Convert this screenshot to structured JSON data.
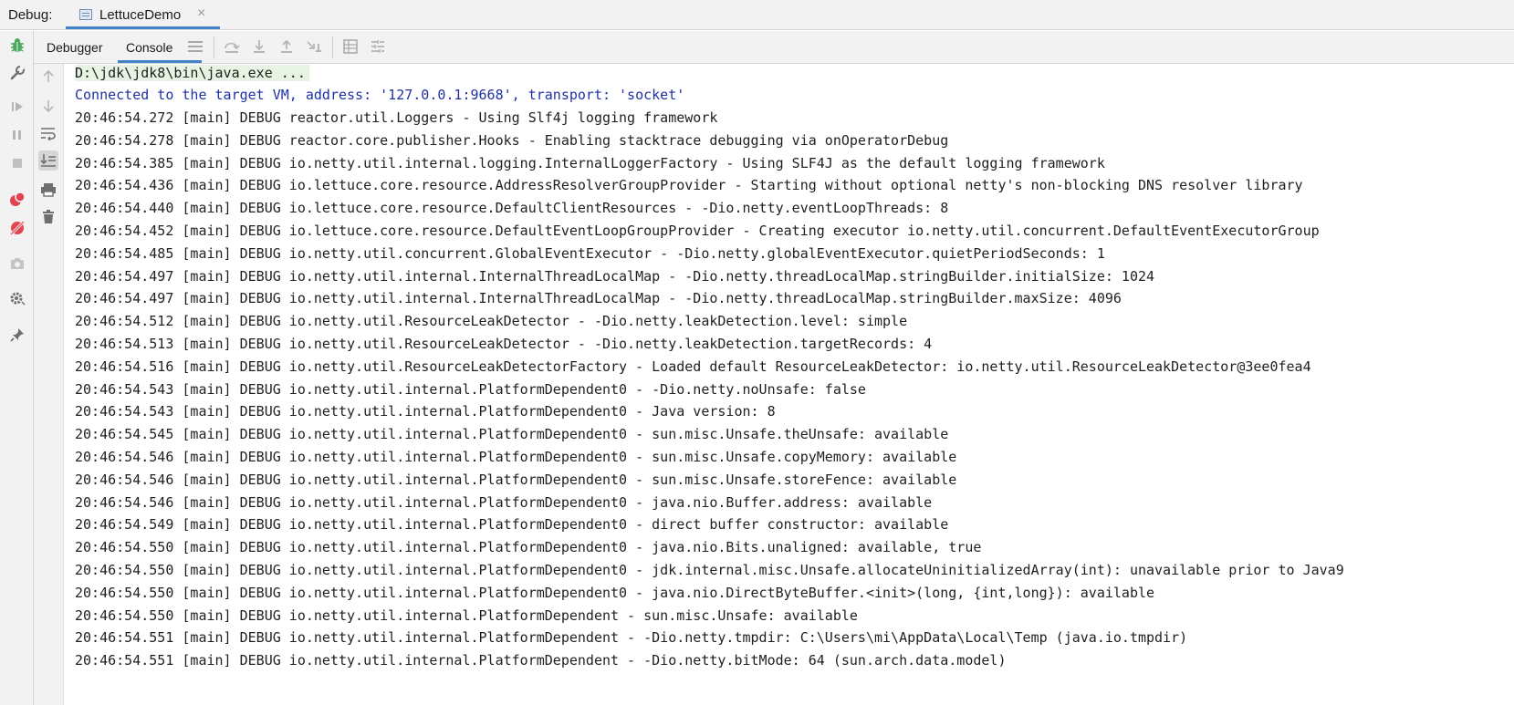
{
  "debug_bar": {
    "label": "Debug:",
    "run_tab": {
      "label": "LettuceDemo",
      "icon": "run-config-icon",
      "close": "×"
    }
  },
  "subbar": {
    "tabs": [
      {
        "label": "Debugger"
      },
      {
        "label": "Console"
      }
    ],
    "active_tab": "Console"
  },
  "left_toolbar": {
    "icons": [
      "debug-bug-icon",
      "wrench-icon",
      "resume-icon",
      "pause-icon",
      "stop-icon",
      "view-breakpoints-icon",
      "mute-breakpoints-icon",
      "camera-icon",
      "settings-icon",
      "pin-icon"
    ]
  },
  "gutter": {
    "icons": [
      "scroll-up-icon",
      "scroll-down-icon",
      "soft-wrap-icon",
      "scroll-to-end-icon",
      "print-icon",
      "clear-icon"
    ]
  },
  "console": {
    "command": "D:\\jdk\\jdk8\\bin\\java.exe ...",
    "connected": "Connected to the target VM, address: '127.0.0.1:9668', transport: 'socket'",
    "lines": [
      "20:46:54.272 [main] DEBUG reactor.util.Loggers - Using Slf4j logging framework",
      "20:46:54.278 [main] DEBUG reactor.core.publisher.Hooks - Enabling stacktrace debugging via onOperatorDebug",
      "20:46:54.385 [main] DEBUG io.netty.util.internal.logging.InternalLoggerFactory - Using SLF4J as the default logging framework",
      "20:46:54.436 [main] DEBUG io.lettuce.core.resource.AddressResolverGroupProvider - Starting without optional netty's non-blocking DNS resolver library",
      "20:46:54.440 [main] DEBUG io.lettuce.core.resource.DefaultClientResources - -Dio.netty.eventLoopThreads: 8",
      "20:46:54.452 [main] DEBUG io.lettuce.core.resource.DefaultEventLoopGroupProvider - Creating executor io.netty.util.concurrent.DefaultEventExecutorGroup",
      "20:46:54.485 [main] DEBUG io.netty.util.concurrent.GlobalEventExecutor - -Dio.netty.globalEventExecutor.quietPeriodSeconds: 1",
      "20:46:54.497 [main] DEBUG io.netty.util.internal.InternalThreadLocalMap - -Dio.netty.threadLocalMap.stringBuilder.initialSize: 1024",
      "20:46:54.497 [main] DEBUG io.netty.util.internal.InternalThreadLocalMap - -Dio.netty.threadLocalMap.stringBuilder.maxSize: 4096",
      "20:46:54.512 [main] DEBUG io.netty.util.ResourceLeakDetector - -Dio.netty.leakDetection.level: simple",
      "20:46:54.513 [main] DEBUG io.netty.util.ResourceLeakDetector - -Dio.netty.leakDetection.targetRecords: 4",
      "20:46:54.516 [main] DEBUG io.netty.util.ResourceLeakDetectorFactory - Loaded default ResourceLeakDetector: io.netty.util.ResourceLeakDetector@3ee0fea4",
      "20:46:54.543 [main] DEBUG io.netty.util.internal.PlatformDependent0 - -Dio.netty.noUnsafe: false",
      "20:46:54.543 [main] DEBUG io.netty.util.internal.PlatformDependent0 - Java version: 8",
      "20:46:54.545 [main] DEBUG io.netty.util.internal.PlatformDependent0 - sun.misc.Unsafe.theUnsafe: available",
      "20:46:54.546 [main] DEBUG io.netty.util.internal.PlatformDependent0 - sun.misc.Unsafe.copyMemory: available",
      "20:46:54.546 [main] DEBUG io.netty.util.internal.PlatformDependent0 - sun.misc.Unsafe.storeFence: available",
      "20:46:54.546 [main] DEBUG io.netty.util.internal.PlatformDependent0 - java.nio.Buffer.address: available",
      "20:46:54.549 [main] DEBUG io.netty.util.internal.PlatformDependent0 - direct buffer constructor: available",
      "20:46:54.550 [main] DEBUG io.netty.util.internal.PlatformDependent0 - java.nio.Bits.unaligned: available, true",
      "20:46:54.550 [main] DEBUG io.netty.util.internal.PlatformDependent0 - jdk.internal.misc.Unsafe.allocateUninitializedArray(int): unavailable prior to Java9",
      "20:46:54.550 [main] DEBUG io.netty.util.internal.PlatformDependent0 - java.nio.DirectByteBuffer.<init>(long, {int,long}): available",
      "20:46:54.550 [main] DEBUG io.netty.util.internal.PlatformDependent - sun.misc.Unsafe: available",
      "20:46:54.551 [main] DEBUG io.netty.util.internal.PlatformDependent - -Dio.netty.tmpdir: C:\\Users\\mi\\AppData\\Local\\Temp (java.io.tmpdir)",
      "20:46:54.551 [main] DEBUG io.netty.util.internal.PlatformDependent - -Dio.netty.bitMode: 64 (sun.arch.data.model)"
    ]
  }
}
